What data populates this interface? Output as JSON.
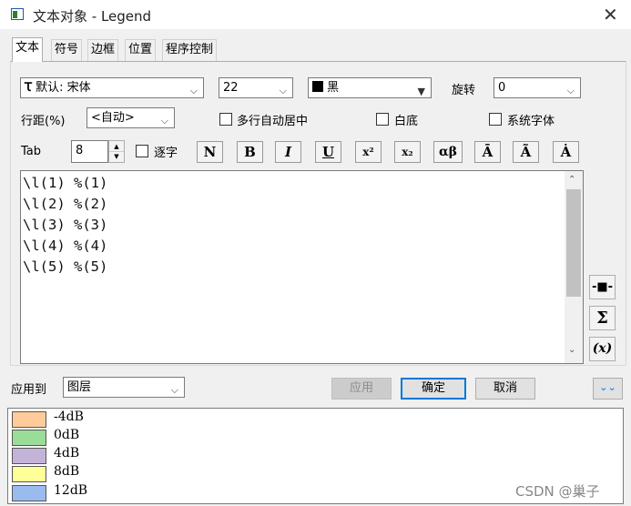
{
  "window": {
    "title": "文本对象 - Legend",
    "close_glyph": "✕"
  },
  "tabs": [
    {
      "label": "文本",
      "active": true
    },
    {
      "label": "符号",
      "active": false
    },
    {
      "label": "边框",
      "active": false
    },
    {
      "label": "位置",
      "active": false
    },
    {
      "label": "程序控制",
      "active": false
    }
  ],
  "font": {
    "value": "默认: 宋体",
    "icon": "truetype-icon"
  },
  "size": {
    "value": "22"
  },
  "color": {
    "value": "黑",
    "swatch": "#000000"
  },
  "rotate": {
    "label": "旋转",
    "value": "0"
  },
  "line_spacing": {
    "label": "行距(%)",
    "value": "<自动>"
  },
  "checkboxes": {
    "multiline_center": "多行自动居中",
    "white_bg": "白底",
    "system_font": "系统字体",
    "per_char": "逐字"
  },
  "tab": {
    "label": "Tab",
    "value": "8"
  },
  "format_buttons": [
    "N",
    "B",
    "I",
    "U",
    "x²",
    "x₂",
    "αβ",
    "Ā",
    "Ã",
    "Ȧ"
  ],
  "text_lines": [
    "\\l(1) %(1)",
    "\\l(2) %(2)",
    "\\l(3) %(3)",
    "\\l(4) %(4)",
    "\\l(5) %(5)"
  ],
  "side_buttons": {
    "symbol": "-■-",
    "sigma": "Σ",
    "variable": "(x)"
  },
  "apply_to": {
    "label": "应用到",
    "value": "图层"
  },
  "buttons": {
    "apply": "应用",
    "ok": "确定",
    "cancel": "取消",
    "expand": "⌄⌄"
  },
  "legend": [
    {
      "label": "-4dB",
      "color": "#ffcc99"
    },
    {
      "label": "0dB",
      "color": "#99dd99"
    },
    {
      "label": "4dB",
      "color": "#c4b3d9"
    },
    {
      "label": "8dB",
      "color": "#ffff99"
    },
    {
      "label": "12dB",
      "color": "#99bbee"
    }
  ],
  "watermark": "CSDN @巢子"
}
